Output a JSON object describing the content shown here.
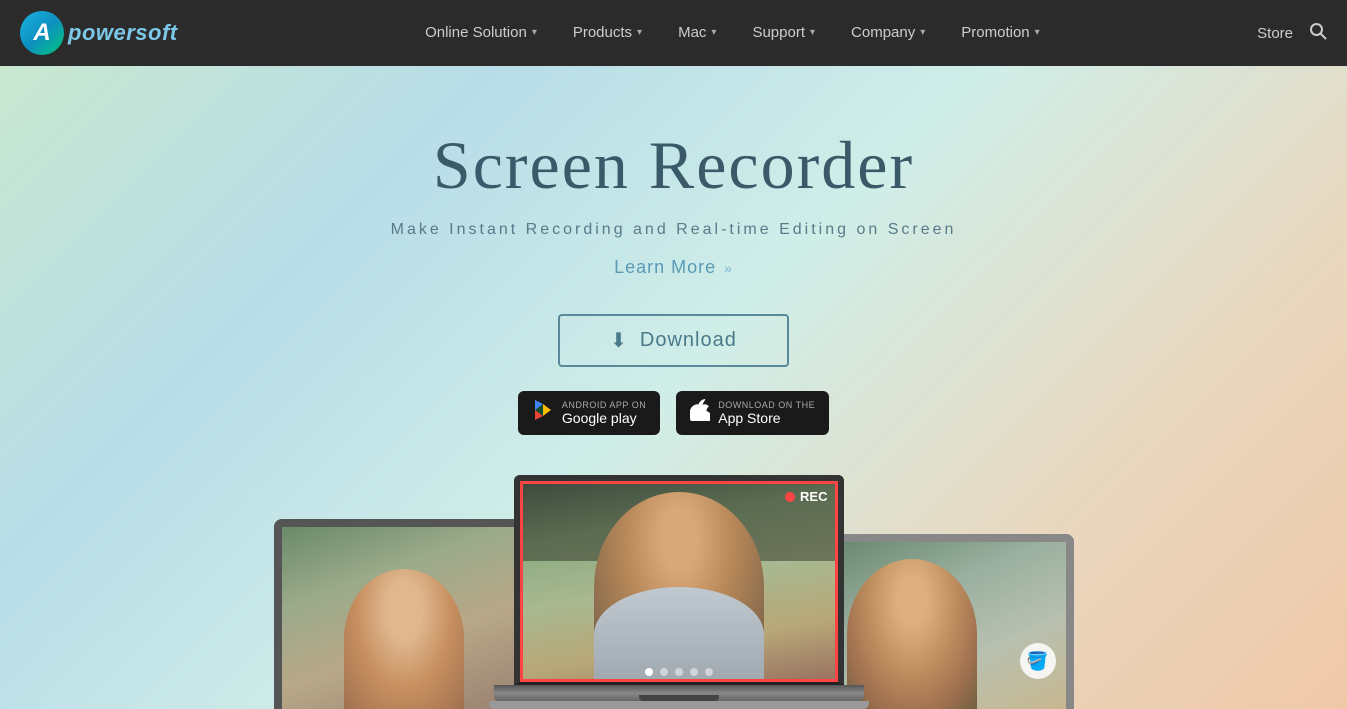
{
  "brand": {
    "logo_letter": "A",
    "name": "powersoft"
  },
  "nav": {
    "items": [
      {
        "id": "online-solution",
        "label": "Online Solution",
        "has_dropdown": true
      },
      {
        "id": "products",
        "label": "Products",
        "has_dropdown": true
      },
      {
        "id": "mac",
        "label": "Mac",
        "has_dropdown": true
      },
      {
        "id": "support",
        "label": "Support",
        "has_dropdown": true
      },
      {
        "id": "company",
        "label": "Company",
        "has_dropdown": true
      },
      {
        "id": "promotion",
        "label": "Promotion",
        "has_dropdown": true
      }
    ],
    "store_label": "Store",
    "search_aria": "Search"
  },
  "hero": {
    "title": "Screen Recorder",
    "subtitle": "Make Instant Recording and Real-time Editing on Screen",
    "learn_more": "Learn More",
    "download": "Download",
    "google_play_top": "ANDROID APP ON",
    "google_play_bottom": "Google play",
    "app_store_top": "Download on the",
    "app_store_bottom": "App Store"
  },
  "recording_badge": {
    "dot_color": "#ff4444",
    "label": "REC"
  },
  "dots": [
    {
      "active": true
    },
    {
      "active": false
    },
    {
      "active": false
    },
    {
      "active": false
    },
    {
      "active": false
    }
  ],
  "colors": {
    "nav_bg": "#2b2b2b",
    "hero_bg_start": "#c8e8d0",
    "hero_bg_end": "#f0c8a8",
    "title_color": "#3a5a6a",
    "subtitle_color": "#5a7a8a",
    "link_color": "#5a9ab5",
    "download_border": "#5a8a9a",
    "rec_color": "#ff4444"
  }
}
